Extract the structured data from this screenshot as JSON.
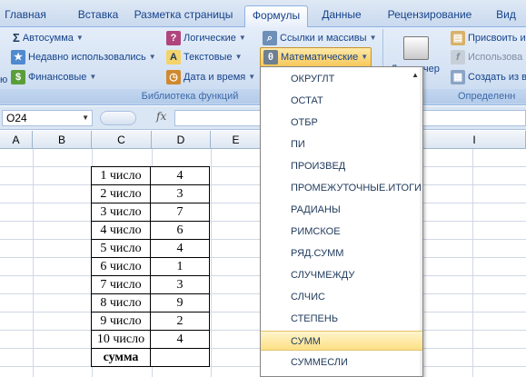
{
  "tabs": [
    {
      "label": "Главная"
    },
    {
      "label": "Вставка"
    },
    {
      "label": "Разметка страницы"
    },
    {
      "label": "Формулы"
    },
    {
      "label": "Данные"
    },
    {
      "label": "Рецензирование"
    },
    {
      "label": "Вид"
    }
  ],
  "ribbon": {
    "autosum": "Автосумма",
    "recent": "Недавно использовались",
    "financial": "Финансовые",
    "logical": "Логические",
    "text": "Текстовые",
    "datetime": "Дата и время",
    "lookup": "Ссылки и массивы",
    "math": "Математические",
    "library_label": "Библиотека функций",
    "dispatcher": "Диспетчер",
    "assign_name": "Присвоить им",
    "use_in_formula": "Использова",
    "create_from": "Создать из в",
    "defined_label": "Определенн",
    "left_cut": "ю"
  },
  "formula_bar": {
    "name_box": "O24",
    "fx": "fx",
    "formula": ""
  },
  "columns": [
    "A",
    "B",
    "C",
    "D",
    "E",
    "I"
  ],
  "table": {
    "rows": [
      {
        "label": "1 число",
        "value": "4"
      },
      {
        "label": "2 число",
        "value": "3"
      },
      {
        "label": "3 число",
        "value": "7"
      },
      {
        "label": "4 число",
        "value": "6"
      },
      {
        "label": "5 число",
        "value": "4"
      },
      {
        "label": "6 число",
        "value": "1"
      },
      {
        "label": "7 число",
        "value": "3"
      },
      {
        "label": "8 число",
        "value": "9"
      },
      {
        "label": "9 число",
        "value": "2"
      },
      {
        "label": "10 число",
        "value": "4"
      }
    ],
    "total_label": "сумма",
    "total_value": ""
  },
  "dropdown": {
    "items": [
      "ОКРУГЛТ",
      "ОСТАТ",
      "ОТБР",
      "ПИ",
      "ПРОИЗВЕД",
      "ПРОМЕЖУТОЧНЫЕ.ИТОГИ",
      "РАДИАНЫ",
      "РИМСКОЕ",
      "РЯД.СУММ",
      "СЛУЧМЕЖДУ",
      "СЛЧИС",
      "СТЕПЕНЬ",
      "СУММ",
      "СУММЕСЛИ"
    ],
    "highlighted": "СУММ"
  },
  "colors": {
    "ribbon_text": "#15428b",
    "highlight": "#fddf85",
    "grid": "#d0d7e5"
  }
}
